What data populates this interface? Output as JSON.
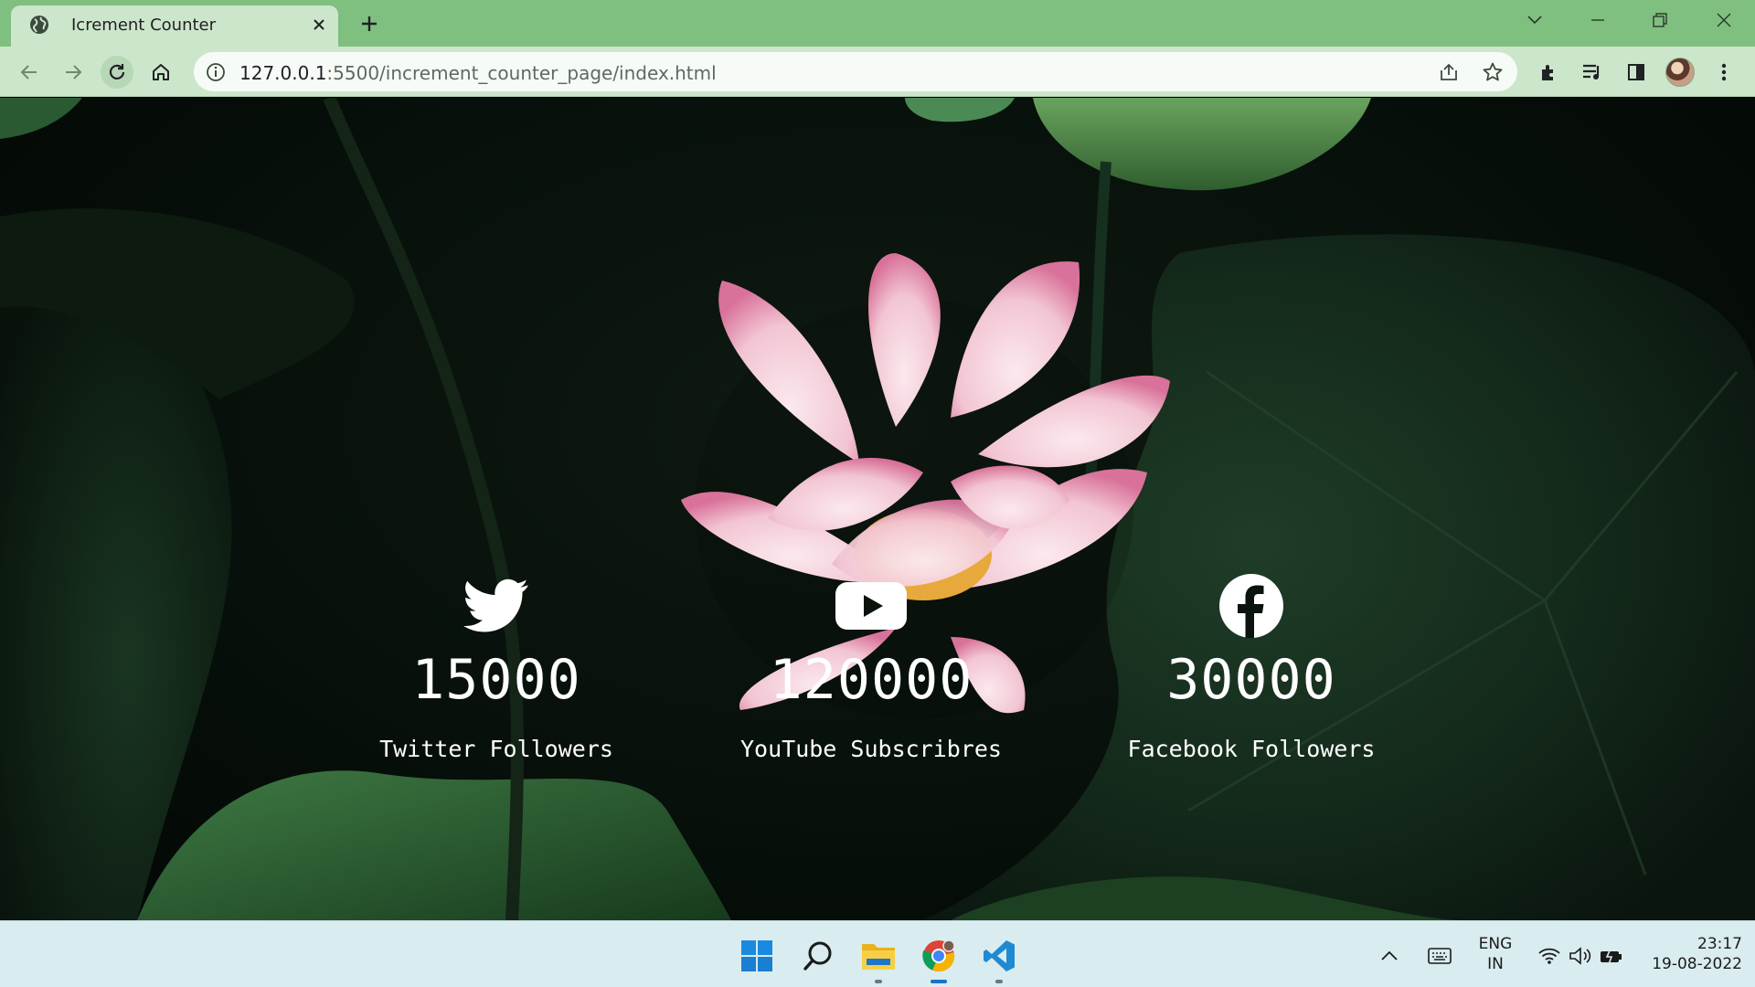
{
  "browser": {
    "tab_title": "Icrement Counter",
    "url_host": "127.0.0.1",
    "url_path": ":5500/increment_counter_page/index.html"
  },
  "counters": [
    {
      "icon": "twitter-icon",
      "value": "15000",
      "label": "Twitter Followers"
    },
    {
      "icon": "youtube-icon",
      "value": "120000",
      "label": "YouTube Subscribres"
    },
    {
      "icon": "facebook-icon",
      "value": "30000",
      "label": "Facebook Followers"
    }
  ],
  "taskbar": {
    "apps": [
      "start-icon",
      "search-icon",
      "file-explorer-icon",
      "chrome-icon",
      "vscode-icon"
    ],
    "lang_line1": "ENG",
    "lang_line2": "IN",
    "time": "23:17",
    "date": "19-08-2022"
  },
  "colors": {
    "chrome_frame": "#7fbf7f",
    "chrome_toolbar": "#cce6cc",
    "taskbar": "#d9ecef"
  }
}
